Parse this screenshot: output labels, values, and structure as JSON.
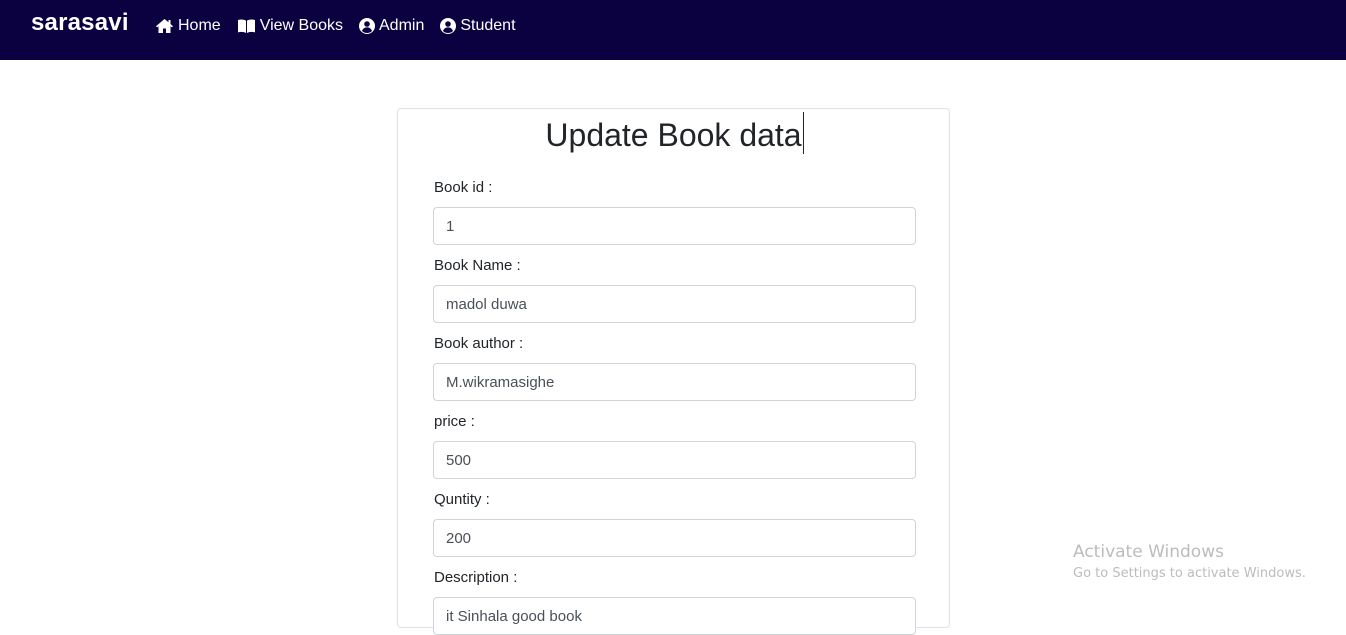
{
  "navbar": {
    "brand": "sarasavi",
    "items": [
      {
        "label": "Home",
        "icon": "home-icon"
      },
      {
        "label": "View Books",
        "icon": "book-open-icon"
      },
      {
        "label": "Admin",
        "icon": "user-circle-icon"
      },
      {
        "label": "Student",
        "icon": "user-circle-icon"
      }
    ],
    "background": "#0b0140"
  },
  "form": {
    "title": "Update Book data",
    "fields": [
      {
        "label": "Book id :",
        "value": "1"
      },
      {
        "label": "Book Name :",
        "value": "madol duwa"
      },
      {
        "label": "Book author :",
        "value": "M.wikramasighe"
      },
      {
        "label": "price :",
        "value": "500"
      },
      {
        "label": "Quntity :",
        "value": "200"
      },
      {
        "label": "Description :",
        "value": "it Sinhala good book"
      }
    ]
  },
  "watermark": {
    "title": "Activate Windows",
    "subtitle": "Go to Settings to activate Windows."
  }
}
